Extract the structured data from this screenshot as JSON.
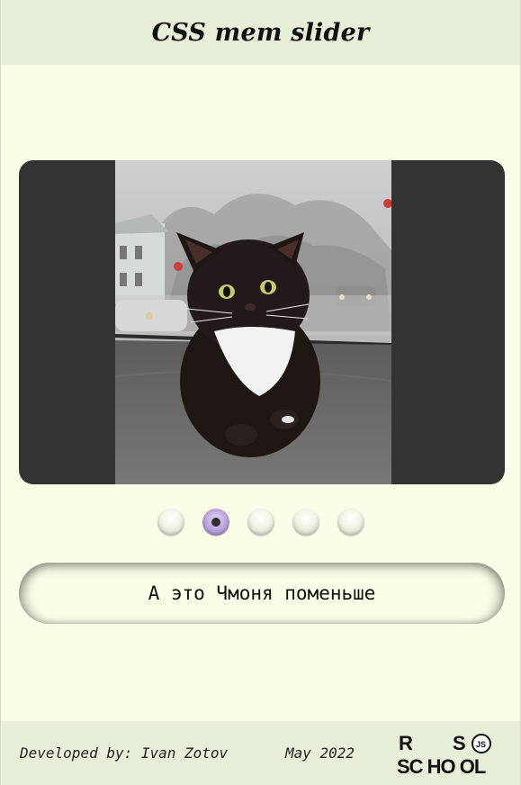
{
  "header": {
    "title": "CSS mem slider"
  },
  "slider": {
    "image_alt": "black and white kitten sitting on a car dashboard",
    "dots_count": 5,
    "active_dot": 2
  },
  "caption": {
    "text": "А это Чмоня поменьше"
  },
  "footer": {
    "developer": "Developed by: Ivan Zotov",
    "date": "May 2022",
    "logo_text": "RS SCHOOL",
    "logo_badge": "JS"
  },
  "colors": {
    "background": "#fafee6",
    "header_bg": "#e8efd9",
    "slider_bg": "#333333",
    "active_dot": "#b79fdb"
  }
}
